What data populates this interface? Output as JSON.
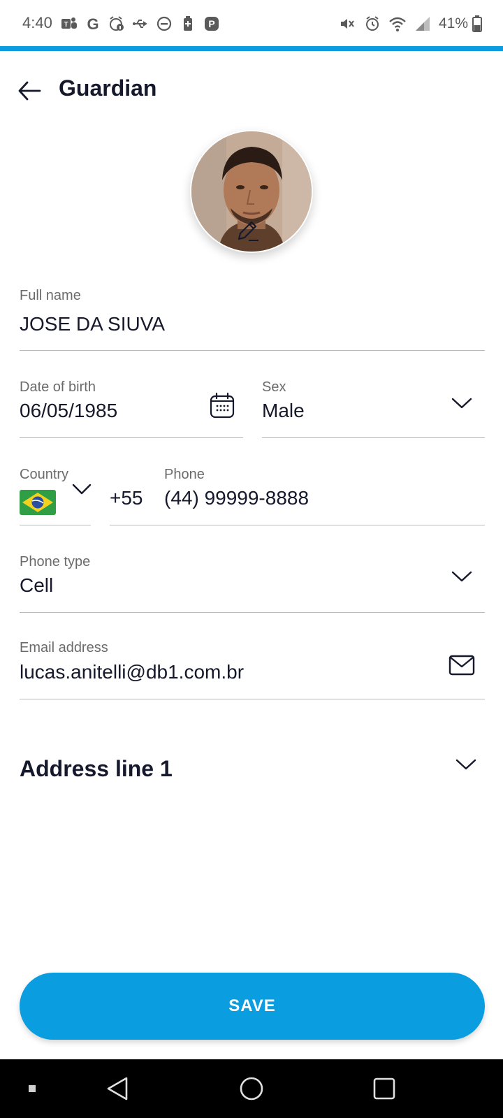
{
  "status_bar": {
    "time": "4:40",
    "battery_percent": "41%",
    "left_icons": [
      "teams-icon",
      "google-icon",
      "alarm-info-icon",
      "usb-icon",
      "do-not-disturb-icon",
      "battery-saver-icon",
      "app-p-icon"
    ],
    "right_icons": [
      "vibrate-mute-icon",
      "alarm-icon",
      "wifi-icon",
      "signal-icon",
      "battery-icon"
    ]
  },
  "header": {
    "title": "Guardian"
  },
  "form": {
    "full_name": {
      "label": "Full name",
      "value": "JOSE DA SIUVA"
    },
    "dob": {
      "label": "Date of birth",
      "value": "06/05/1985"
    },
    "sex": {
      "label": "Sex",
      "value": "Male"
    },
    "country": {
      "label": "Country",
      "flag": "brazil-flag-icon"
    },
    "phone": {
      "label": "Phone",
      "prefix": "+55",
      "value": "(44) 99999-8888"
    },
    "phone_type": {
      "label": "Phone type",
      "value": "Cell"
    },
    "email": {
      "label": "Email address",
      "value": "lucas.anitelli@db1.com.br"
    }
  },
  "address": {
    "title": "Address line 1"
  },
  "save_button": {
    "label": "SAVE"
  },
  "colors": {
    "accent": "#0a9ee1",
    "text_primary": "#16192b",
    "label": "#6b6b6b"
  }
}
